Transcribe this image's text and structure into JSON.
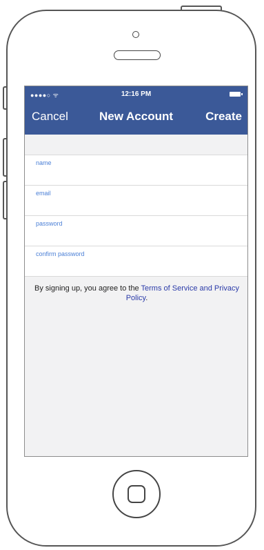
{
  "status_bar": {
    "signal": "●●●●○ ᯤ",
    "time": "12:16 PM"
  },
  "nav": {
    "cancel_label": "Cancel",
    "title": "New Account",
    "create_label": "Create"
  },
  "form": {
    "fields": [
      {
        "placeholder": "name"
      },
      {
        "placeholder": "email"
      },
      {
        "placeholder": "password"
      },
      {
        "placeholder": "confirm password"
      }
    ]
  },
  "terms": {
    "prefix": "By signing up, you agree to the ",
    "tos_link": "Terms of Service",
    "conjunction": " and ",
    "privacy_link": "Privacy Policy",
    "suffix": "."
  },
  "colors": {
    "navbar": "#3b5998",
    "link": "#2a3aa8",
    "placeholder": "#4a7fd6"
  }
}
